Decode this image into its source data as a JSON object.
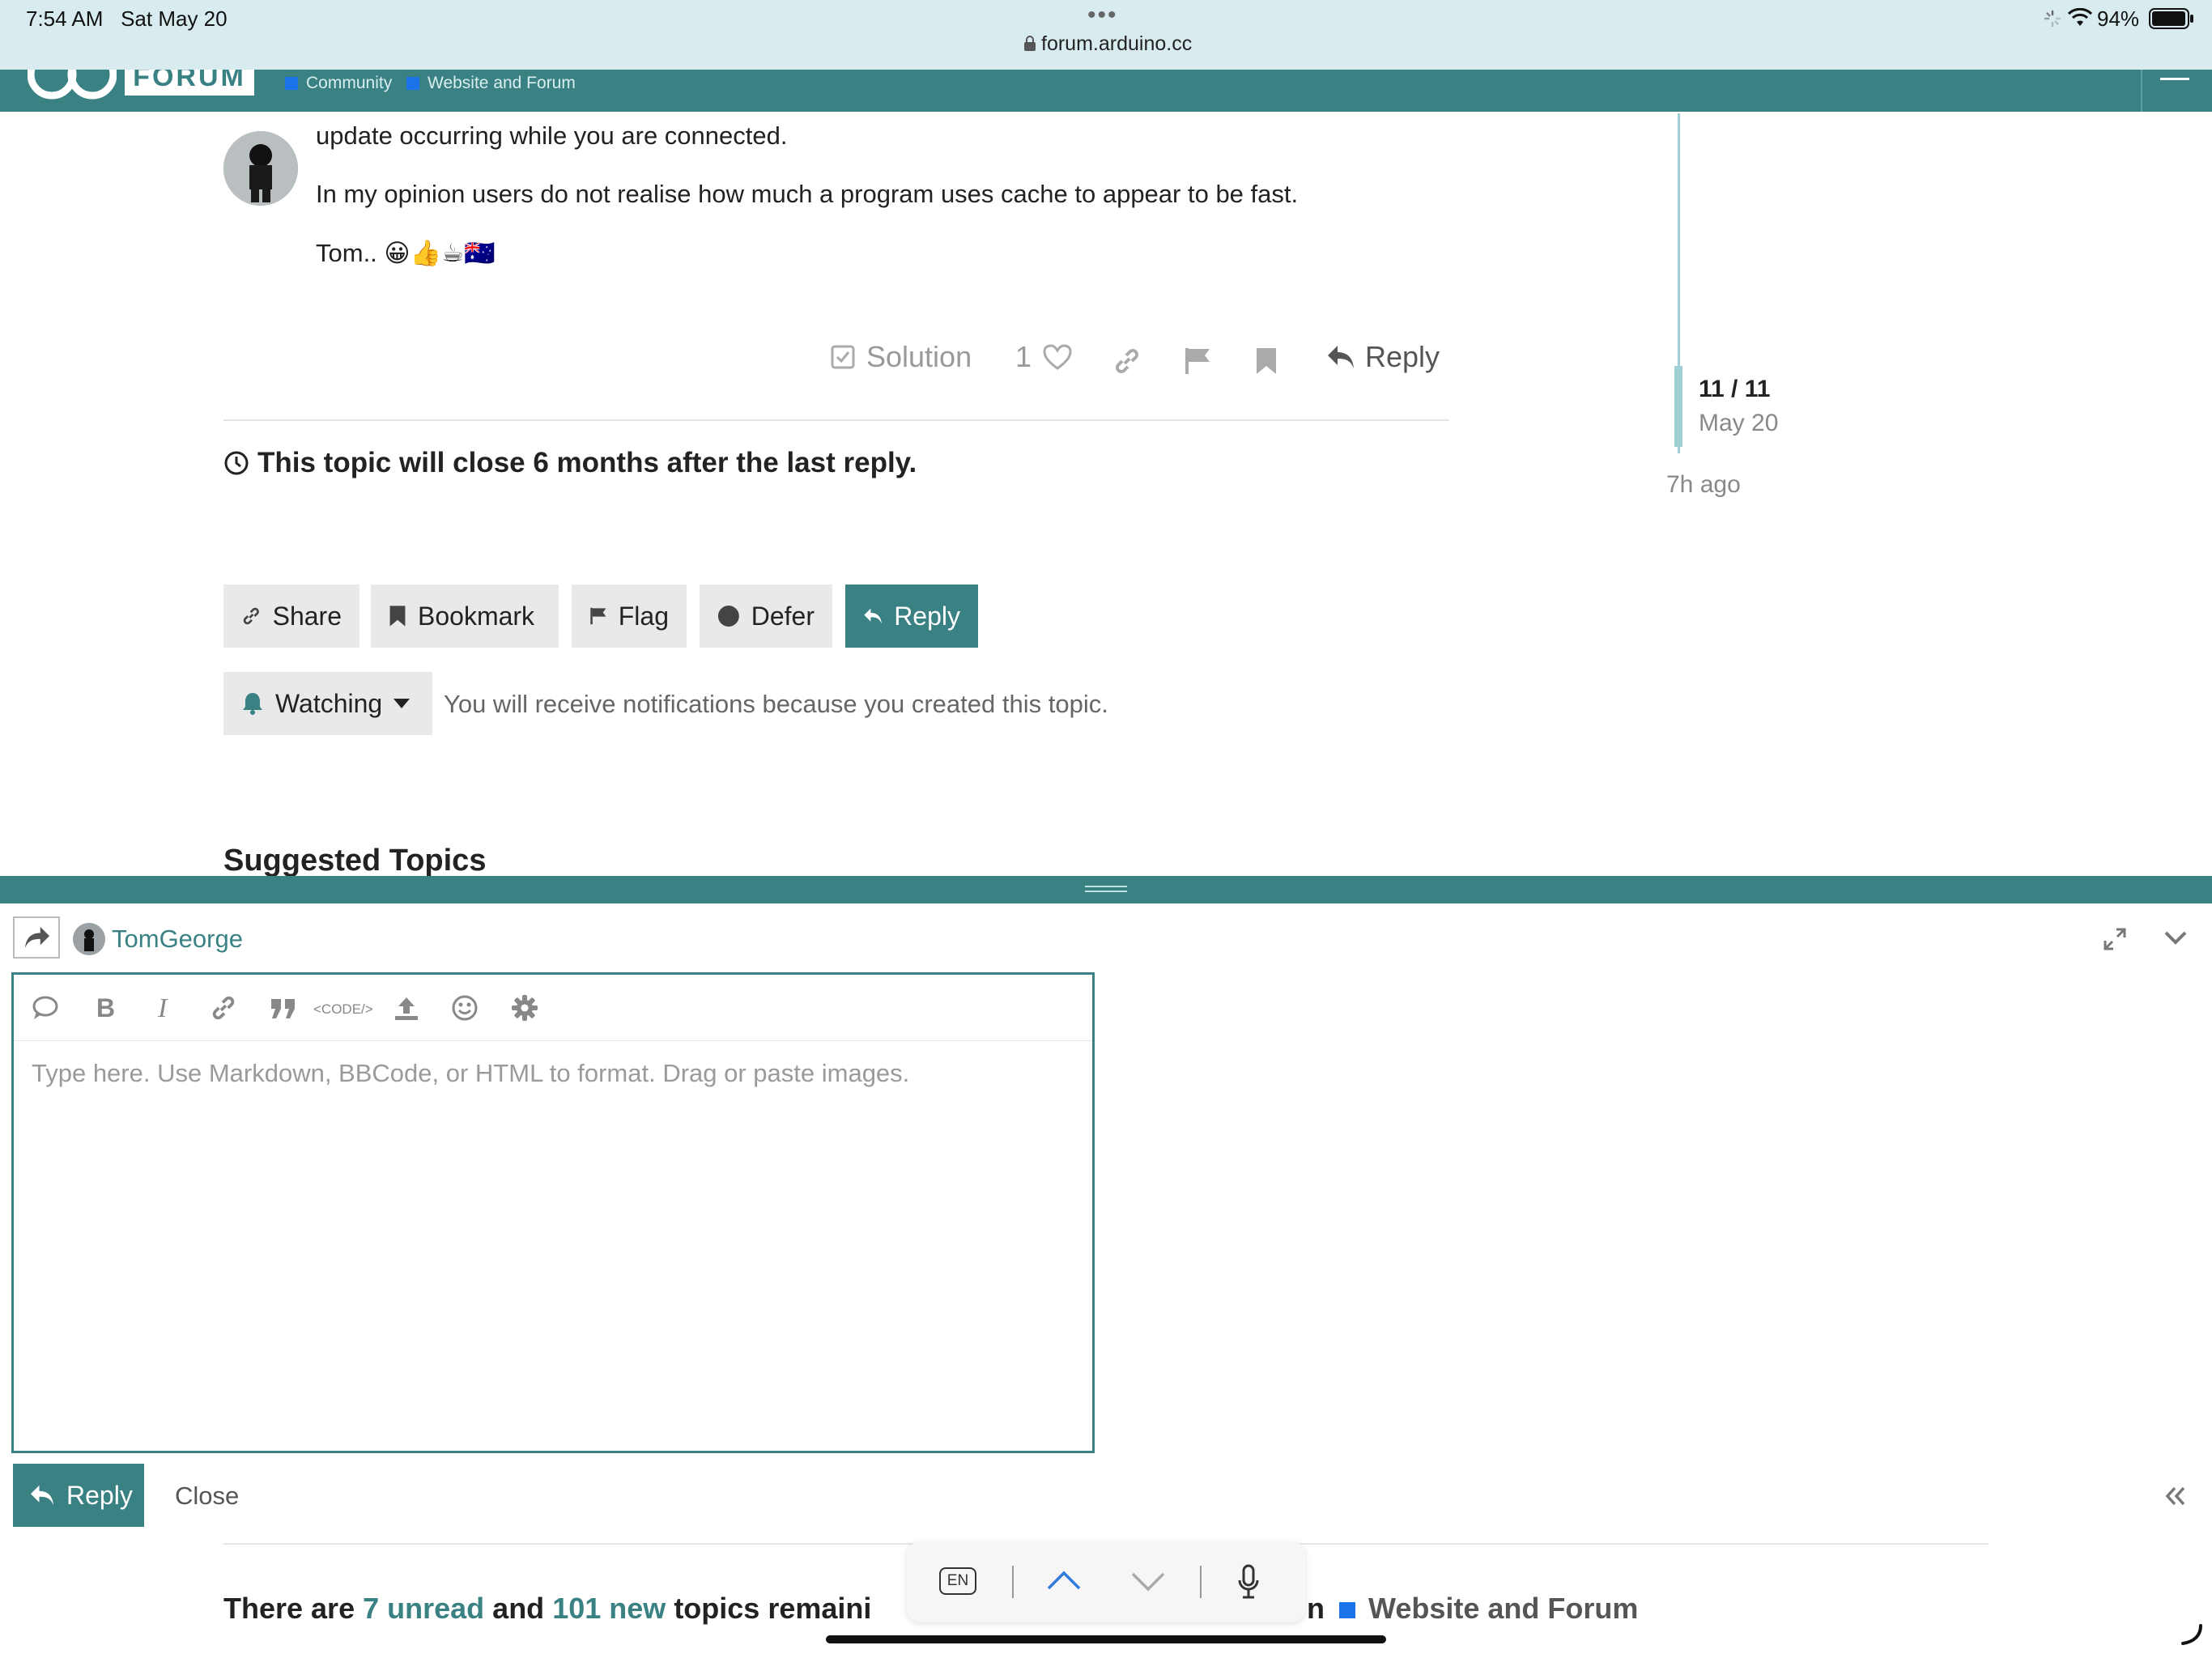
{
  "status_bar": {
    "time": "7:54 AM",
    "date": "Sat May 20",
    "url": "forum.arduino.cc",
    "battery": "94%"
  },
  "header": {
    "logo_text": "FORUM",
    "breadcrumbs": [
      {
        "label": "Community",
        "color": "#1a73e8"
      },
      {
        "label": "Website and Forum",
        "color": "#1a73e8"
      }
    ]
  },
  "post": {
    "line1": "update occurring while you are connected.",
    "line2": "In my opinion users do not realise how much a program uses cache to appear to be fast.",
    "signature": "Tom.. 😀👍☕🇦🇺",
    "actions": {
      "solution_label": "Solution",
      "like_count": "1",
      "reply_label": "Reply"
    }
  },
  "topic_notice": "This topic will close 6 months after the last reply.",
  "timeline": {
    "position": "11 / 11",
    "date": "May 20",
    "ago": "7h ago"
  },
  "topic_buttons": {
    "share": "Share",
    "bookmark": "Bookmark",
    "flag": "Flag",
    "defer": "Defer",
    "reply": "Reply"
  },
  "notification": {
    "level": "Watching",
    "reason": "You will receive notifications because you created this topic."
  },
  "suggested_heading": "Suggested Topics",
  "composer": {
    "username": "TomGeorge",
    "code_label": "<CODE/>",
    "placeholder": "Type here. Use Markdown, BBCode, or HTML to format. Drag or paste images.",
    "reply_label": "Reply",
    "close_label": "Close"
  },
  "footer_line": {
    "prefix": "There are",
    "unread": "7 unread",
    "and": "and",
    "new": "101 new",
    "suffix": "topics remaini",
    "tail": "n",
    "category": "Website and Forum"
  },
  "keyboard": {
    "lang": "EN"
  }
}
